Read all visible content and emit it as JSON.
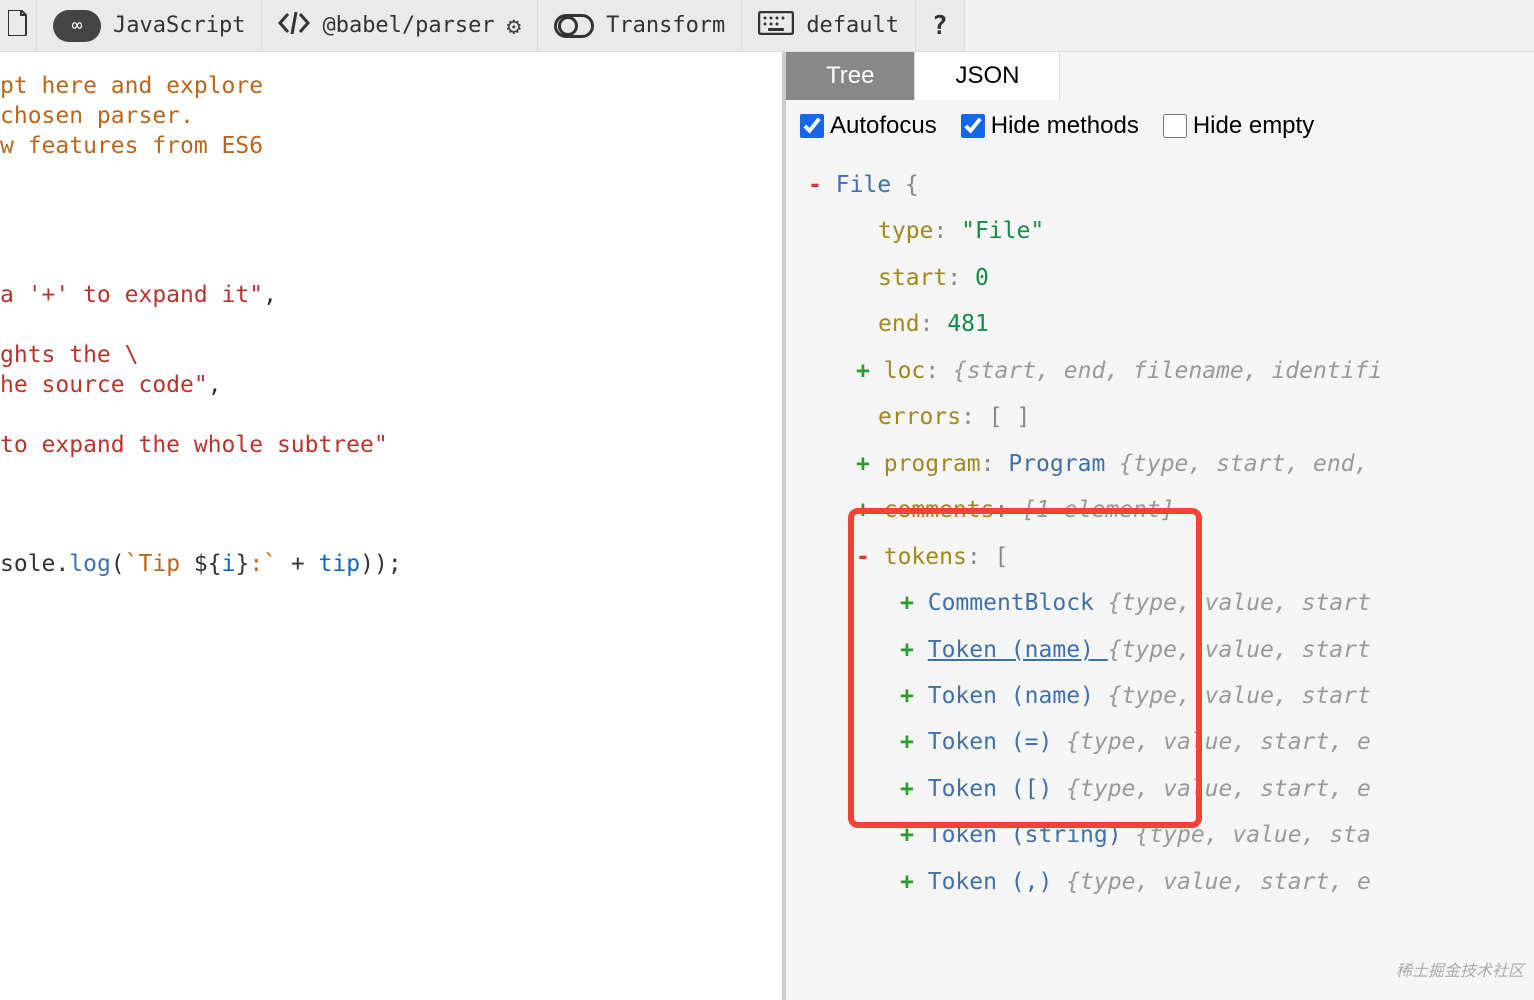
{
  "toolbar": {
    "language": "JavaScript",
    "parser": "@babel/parser",
    "transform": "Transform",
    "keymap": "default",
    "help": "?"
  },
  "editor": {
    "lines": [
      {
        "segments": [
          {
            "text": "pt here and explore",
            "cls": "tmpl"
          }
        ]
      },
      {
        "segments": [
          {
            "text": "chosen parser.",
            "cls": "tmpl"
          }
        ]
      },
      {
        "segments": [
          {
            "text": "w features from ES6",
            "cls": "tmpl"
          }
        ]
      },
      {
        "segments": []
      },
      {
        "segments": []
      },
      {
        "segments": []
      },
      {
        "segments": []
      },
      {
        "segments": [
          {
            "text": "a '+' to expand it\"",
            "cls": "str"
          },
          {
            "text": ",",
            "cls": "punct"
          }
        ]
      },
      {
        "segments": []
      },
      {
        "segments": [
          {
            "text": "ghts the \\",
            "cls": "str"
          }
        ]
      },
      {
        "segments": [
          {
            "text": "he source code\"",
            "cls": "str"
          },
          {
            "text": ",",
            "cls": "punct"
          }
        ]
      },
      {
        "segments": []
      },
      {
        "segments": [
          {
            "text": "to expand the whole subtree\"",
            "cls": "str"
          }
        ]
      },
      {
        "segments": []
      },
      {
        "segments": []
      },
      {
        "segments": []
      },
      {
        "segments": [
          {
            "text": "sole",
            "cls": "kw"
          },
          {
            "text": ".",
            "cls": "punct"
          },
          {
            "text": "log",
            "cls": "fn"
          },
          {
            "text": "(",
            "cls": "punct"
          },
          {
            "text": "`Tip ",
            "cls": "tmpl"
          },
          {
            "text": "${",
            "cls": "punct"
          },
          {
            "text": "i",
            "cls": "var"
          },
          {
            "text": "}",
            "cls": "punct"
          },
          {
            "text": ":`",
            "cls": "tmpl"
          },
          {
            "text": " + ",
            "cls": "punct"
          },
          {
            "text": "tip",
            "cls": "var"
          },
          {
            "text": "));",
            "cls": "punct"
          }
        ]
      }
    ]
  },
  "tabs": {
    "tree": "Tree",
    "json": "JSON"
  },
  "options": {
    "autofocus": "Autofocus",
    "hide_methods": "Hide methods",
    "hide_empty": "Hide empty"
  },
  "tree": {
    "root_type": "File",
    "type_key": "type",
    "type_value": "\"File\"",
    "start_key": "start",
    "start_value": "0",
    "end_key": "end",
    "end_value": "481",
    "loc_key": "loc",
    "loc_summary": "{start, end, filename, identifi",
    "errors_key": "errors",
    "errors_value": "[ ]",
    "program_key": "program",
    "program_type": "Program",
    "program_summary": "{type, start, end,",
    "comments_key": "comments",
    "comments_summary": "[1 element]",
    "tokens_key": "tokens",
    "tokens": [
      {
        "toggle": "+",
        "name": "CommentBlock",
        "summary": "{type, value, start"
      },
      {
        "toggle": "+",
        "name": "Token (name)",
        "summary": "{type, value, start",
        "underlined": true,
        "trailing_underscore": true
      },
      {
        "toggle": "+",
        "name": "Token (name)",
        "summary": "{type, value, start"
      },
      {
        "toggle": "+",
        "name": "Token (=)",
        "summary": "{type, value, start, e"
      },
      {
        "toggle": "+",
        "name": "Token ([)",
        "summary": "{type, value, start, e"
      },
      {
        "toggle": "+",
        "name": "Token (string)",
        "summary": "{type, value, sta"
      },
      {
        "toggle": "+",
        "name": "Token (,)",
        "summary": "{type, value, start, e"
      }
    ]
  },
  "watermark": "稀土掘金技术社区"
}
